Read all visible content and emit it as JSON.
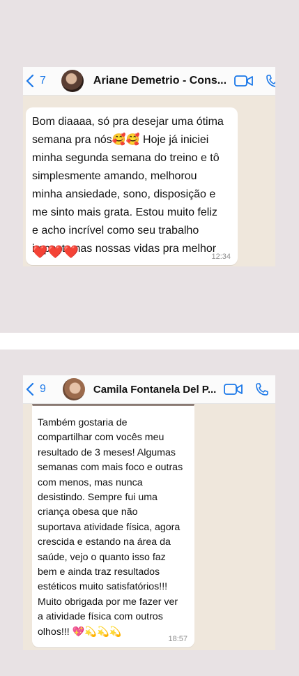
{
  "screens": [
    {
      "back_count": "7",
      "contact_name": "Ariane Demetrio - Cons...",
      "message": "Bom diaaaa, só pra desejar uma ótima\nsemana pra nós🥰🥰 Hoje já iniciei\nminha segunda semana do treino e tô\nsimplesmente amando, melhorou\nminha ansiedade, sono, disposição e\nme sinto mais grata. Estou muito feliz\ne acho incrível como seu trabalho\nimpacta nas nossas vidas pra melhor",
      "hearts": "❤️❤️❤️",
      "time": "12:34"
    },
    {
      "back_count": "9",
      "contact_name": "Camila Fontanela Del P...",
      "message": "Também gostaria de\ncompartilhar com vocês meu\nresultado de 3 meses! Algumas\nsemanas com mais foco e outras\ncom menos, mas nunca\ndesistindo. Sempre fui uma\ncriança obesa que não\nsuportava atividade física, agora\ncrescida e estando na área da\nsaúde, vejo o quanto isso faz\nbem e ainda traz resultados\nestéticos muito satisfatórios!!!\nMuito obrigada por me fazer ver\na atividade física com outros\nolhos!!! 💖💫💫💫",
      "time": "18:57"
    }
  ],
  "icons": {
    "back": "chevron-left-icon",
    "video": "video-call-icon",
    "phone": "phone-icon"
  },
  "colors": {
    "accent": "#1b78e8",
    "chat_background": "#efe7dc",
    "bubble": "#ffffff",
    "page_background": "#e8e2e4"
  }
}
